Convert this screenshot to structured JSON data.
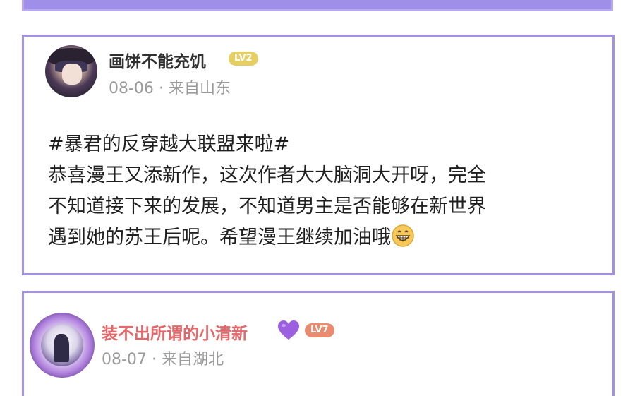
{
  "posts": [
    {
      "username": "画饼不能充饥",
      "level": "LV2",
      "date": "08-06",
      "separator": "·",
      "location": "来自山东",
      "content_lines": [
        "#暴君的反穿越大联盟来啦#",
        "恭喜漫王又添新作，这次作者大大脑洞大开呀，完全",
        "不知道接下来的发展，不知道男主是否能够在新世界",
        "遇到她的苏王后呢。希望漫王继续加油哦"
      ],
      "trailing_icon": "grinning-face-emoji"
    },
    {
      "username": "装不出所谓的小清新",
      "username_icon": "purple-heart-emoji",
      "level": "LV7",
      "date": "08-07",
      "separator": "·",
      "location": "来自湖北"
    }
  ],
  "colors": {
    "card_border": "#a291e5",
    "top_card_fill": "#9f8fe8",
    "level2_badge": "#e5cf62",
    "level7_badge": "#ea8a6f",
    "username2_color": "#e4686a",
    "meta_text": "#9a9a9a"
  }
}
